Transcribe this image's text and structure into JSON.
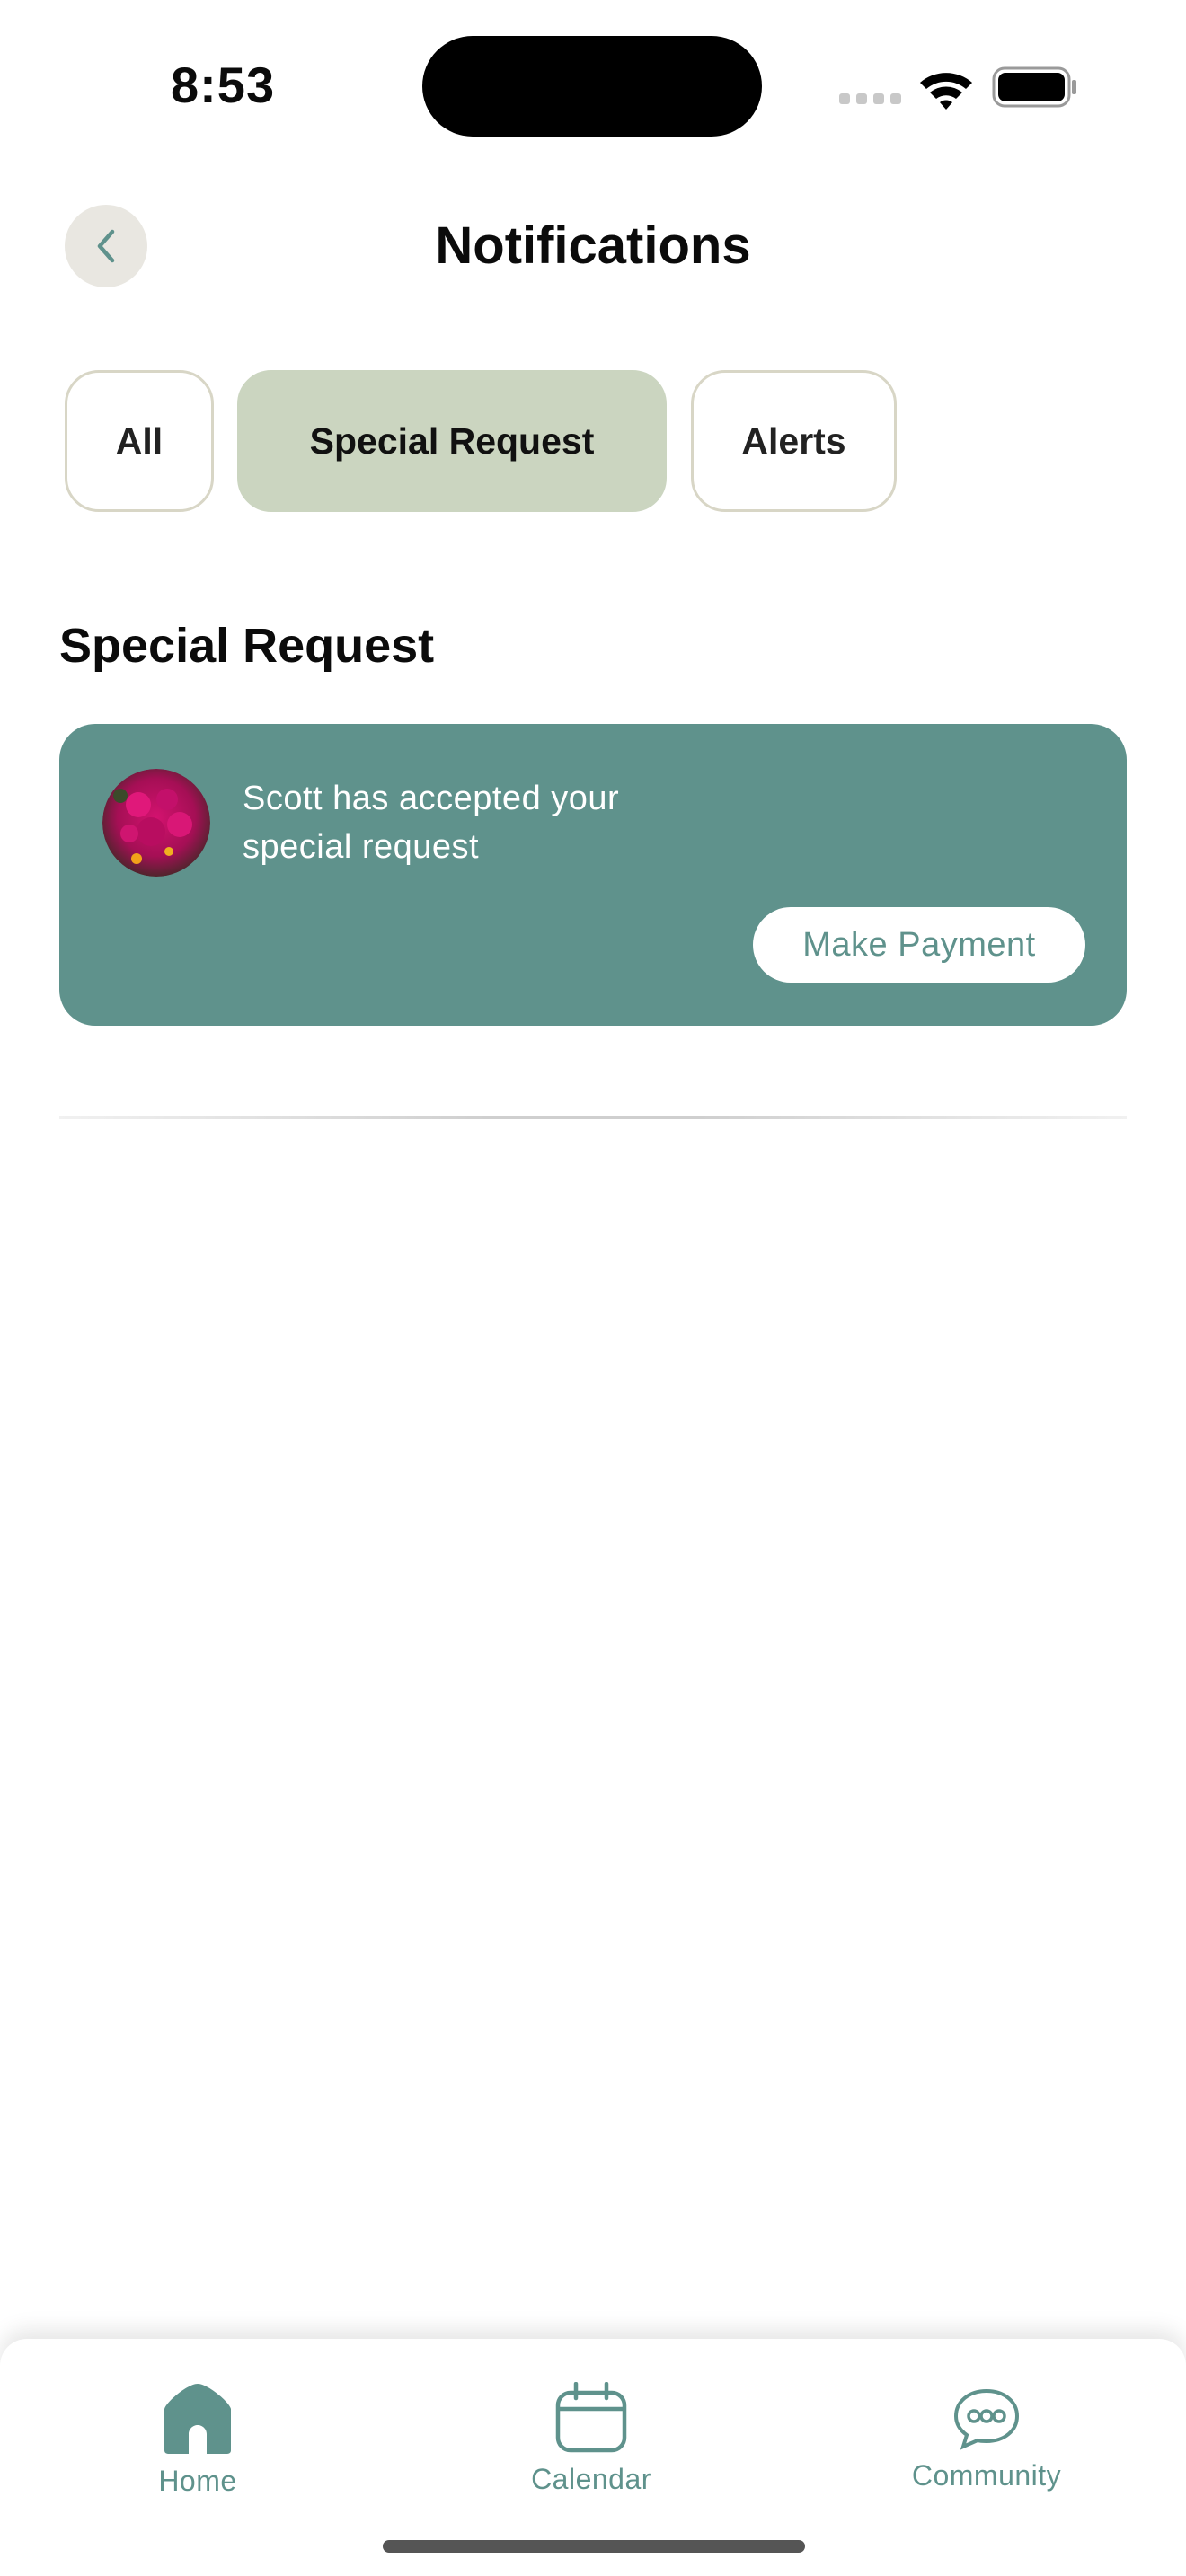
{
  "status_bar": {
    "time": "8:53"
  },
  "header": {
    "title": "Notifications"
  },
  "tabs": [
    {
      "label": "All",
      "active": false
    },
    {
      "label": "Special Request",
      "active": true
    },
    {
      "label": "Alerts",
      "active": false
    }
  ],
  "section": {
    "title": "Special Request"
  },
  "notification": {
    "message": " Scott has accepted your special request",
    "action_label": "Make Payment"
  },
  "bottom_nav": {
    "items": [
      {
        "label": "Home",
        "icon": "home-icon",
        "active": true
      },
      {
        "label": "Calendar",
        "icon": "calendar-icon",
        "active": false
      },
      {
        "label": "Community",
        "icon": "chat-icon",
        "active": false
      }
    ]
  },
  "colors": {
    "accent": "#5f928c",
    "tab_active_bg": "#cbd5c0",
    "tab_border": "#d8d6c6",
    "back_button_bg": "#e9e7e1"
  }
}
